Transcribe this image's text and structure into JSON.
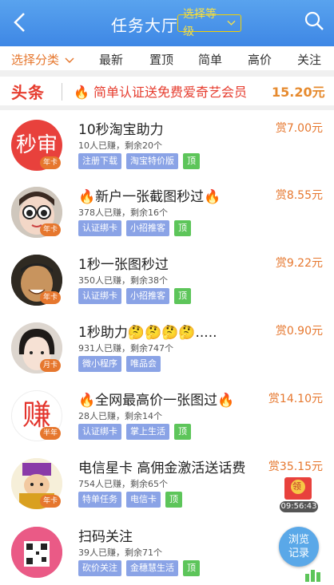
{
  "header": {
    "title": "任务大厅",
    "level_btn": "选择等级"
  },
  "filters": {
    "items": [
      "选择分类",
      "最新",
      "置顶",
      "简单",
      "高价",
      "关注"
    ]
  },
  "headline": {
    "tag": "头条",
    "text": "简单认证送免费爱奇艺会员",
    "price": "15.20元"
  },
  "tasks": [
    {
      "avatar_text": "秒审",
      "badge": "年卡",
      "title": "10秒淘宝助力",
      "meta": "10人已赚，剩余20个",
      "price": "赏7.00元",
      "tags": [
        "注册下载",
        "淘宝特价版",
        "顶"
      ]
    },
    {
      "avatar_text": "",
      "badge": "年卡",
      "title": "新户一张截图秒过",
      "meta": "378人已赚，剩余16个",
      "price": "赏8.55元",
      "tags": [
        "认证绑卡",
        "小招推客",
        "顶"
      ]
    },
    {
      "avatar_text": "",
      "badge": "年卡",
      "title": "1秒一张图秒过",
      "meta": "350人已赚，剩余38个",
      "price": "赏9.22元",
      "tags": [
        "认证绑卡",
        "小招推客",
        "顶"
      ]
    },
    {
      "avatar_text": "",
      "badge": "月卡",
      "title": "1秒助力🤔🤔🤔🤔.....",
      "meta": "931人已赚，剩余747个",
      "price": "赏0.90元",
      "tags": [
        "微小程序",
        "唯品会"
      ]
    },
    {
      "avatar_text": "赚",
      "badge": "半年",
      "title": "全网最高价一张图过",
      "meta": "28人已赚，剩余14个",
      "price": "赏14.10元",
      "tags": [
        "认证绑卡",
        "掌上生活",
        "顶"
      ]
    },
    {
      "avatar_text": "",
      "badge": "年卡",
      "title": "电信星卡 高佣金激活送话费",
      "meta": "754人已赚，剩余65个",
      "price": "赏35.15元",
      "tags": [
        "特单任务",
        "电信卡",
        "顶"
      ]
    },
    {
      "avatar_text": "",
      "badge": "",
      "title": "扫码关注",
      "meta": "39人已赚，剩余71个",
      "price": "",
      "tags": [
        "砍价关注",
        "金穗慧生活",
        "顶"
      ]
    }
  ],
  "redpack": {
    "label": "领",
    "timer": "09:56:43"
  },
  "browse": {
    "line1": "浏览",
    "line2": "记录"
  },
  "colors": {
    "header": "#4a90e8",
    "accent": "#e6772e",
    "tag": "#8aa3e6",
    "top_tag": "#5dc55a"
  }
}
